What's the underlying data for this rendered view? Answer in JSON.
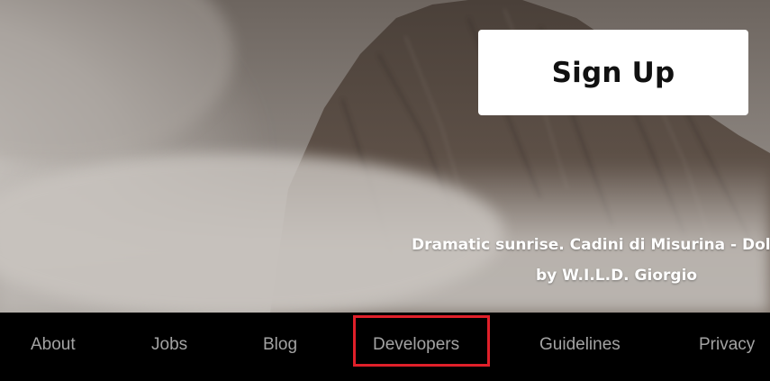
{
  "hero": {
    "signup_label": "Sign Up",
    "caption_title": "Dramatic sunrise. Cadini di Misurina - Dolomites",
    "caption_credit": "by W.I.L.D. Giorgio"
  },
  "footer": {
    "links": [
      {
        "label": "About"
      },
      {
        "label": "Jobs"
      },
      {
        "label": "Blog"
      },
      {
        "label": "Developers"
      },
      {
        "label": "Guidelines"
      },
      {
        "label": "Privacy"
      }
    ],
    "highlight_color": "#e0202a"
  },
  "colors": {
    "footer_bg": "#000000",
    "footer_text": "#a3a3a3",
    "button_bg": "#ffffff",
    "button_text": "#111111"
  }
}
